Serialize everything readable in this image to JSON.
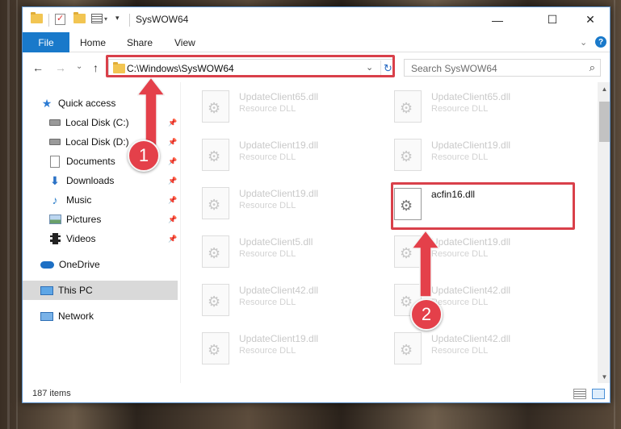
{
  "window": {
    "title": "SysWOW64",
    "minimize_symbol": "—",
    "maximize_symbol": "☐",
    "close_symbol": "✕"
  },
  "ribbon": {
    "tabs": [
      "File",
      "Home",
      "Share",
      "View"
    ],
    "expand_symbol": "⌄",
    "help_symbol": "?"
  },
  "navigation": {
    "back_symbol": "←",
    "forward_symbol": "→",
    "recent_symbol": "⌄",
    "up_symbol": "↑",
    "address": "C:\\Windows\\SysWOW64",
    "address_dropdown_symbol": "⌄",
    "refresh_symbol": "↻",
    "search_placeholder": "Search SysWOW64",
    "search_symbol": "⌕"
  },
  "sidebar": {
    "items": [
      {
        "label": "Quick access",
        "icon": "star-icon",
        "pinned": false
      },
      {
        "label": "Local Disk (C:)",
        "icon": "disk-icon",
        "pinned": true
      },
      {
        "label": "Local Disk (D:)",
        "icon": "disk-icon",
        "pinned": true
      },
      {
        "label": "Documents",
        "icon": "document-icon",
        "pinned": true
      },
      {
        "label": "Downloads",
        "icon": "download-icon",
        "pinned": true
      },
      {
        "label": "Music",
        "icon": "music-icon",
        "pinned": true
      },
      {
        "label": "Pictures",
        "icon": "pictures-icon",
        "pinned": true
      },
      {
        "label": "Videos",
        "icon": "videos-icon",
        "pinned": true
      },
      {
        "label": "OneDrive",
        "icon": "onedrive-icon",
        "pinned": false
      },
      {
        "label": "This PC",
        "icon": "this-pc-icon",
        "pinned": false,
        "selected": true
      },
      {
        "label": "Network",
        "icon": "network-icon",
        "pinned": false
      }
    ],
    "pin_symbol": "📌"
  },
  "files": [
    {
      "name": "UpdateClient65.dll",
      "type": "Resource DLL"
    },
    {
      "name": "UpdateClient65.dll",
      "type": "Resource DLL"
    },
    {
      "name": "UpdateClient19.dll",
      "type": "Resource DLL"
    },
    {
      "name": "UpdateClient19.dll",
      "type": "Resource DLL"
    },
    {
      "name": "UpdateClient19.dll",
      "type": "Resource DLL"
    },
    {
      "name": "acfin16.dll",
      "type": "",
      "highlighted": true
    },
    {
      "name": "UpdateClient5.dll",
      "type": "Resource DLL"
    },
    {
      "name": "UpdateClient19.dll",
      "type": "Resource DLL"
    },
    {
      "name": "UpdateClient42.dll",
      "type": "Resource DLL"
    },
    {
      "name": "UpdateClient42.dll",
      "type": "Resource DLL"
    },
    {
      "name": "UpdateClient19.dll",
      "type": "Resource DLL"
    },
    {
      "name": "UpdateClient42.dll",
      "type": "Resource DLL"
    }
  ],
  "scrollbar": {
    "up_symbol": "▲",
    "down_symbol": "▼"
  },
  "status": {
    "item_count": "187 items"
  },
  "callouts": [
    {
      "number": "1",
      "target": "address-bar"
    },
    {
      "number": "2",
      "target": "acfin16.dll"
    }
  ],
  "colors": {
    "accent": "#1979ca",
    "callout_red": "#d9404a",
    "selected_bg": "#d9d9d9"
  },
  "icons": {
    "file_gear": "⚙",
    "star": "★",
    "download": "⬇",
    "music": "♪"
  }
}
